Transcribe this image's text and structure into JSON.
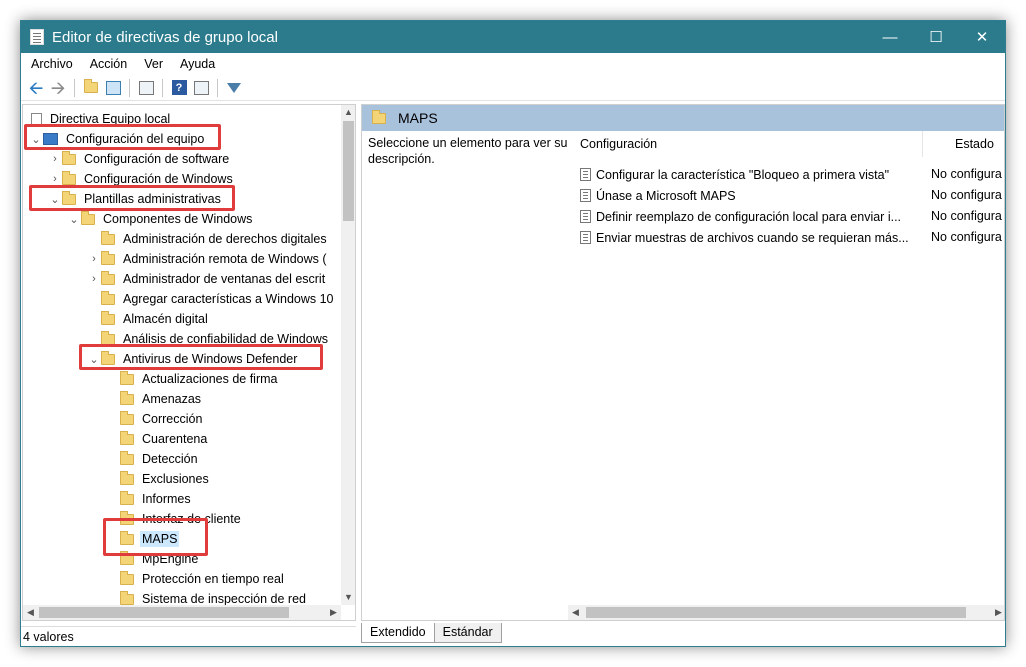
{
  "window": {
    "title": "Editor de directivas de grupo local"
  },
  "menu": [
    "Archivo",
    "Acción",
    "Ver",
    "Ayuda"
  ],
  "toolbar": {
    "icons": [
      "back-icon",
      "forward-icon",
      "up-folder-icon",
      "show-hide-tree-icon",
      "export-list-icon",
      "help-icon",
      "properties-icon",
      "filter-icon"
    ]
  },
  "tree": {
    "root": "Directiva Equipo local",
    "computer_config": "Configuración del equipo",
    "software_config": "Configuración de software",
    "windows_config": "Configuración de Windows",
    "admin_templates": "Plantillas administrativas",
    "windows_components": "Componentes de Windows",
    "items": [
      "Administración de derechos digitales",
      "Administración remota de Windows (",
      "Administrador de ventanas del escrit",
      "Agregar características a Windows 10",
      "Almacén digital",
      "Análisis de confiabilidad de Windows",
      "Antivirus de Windows Defender"
    ],
    "defender_children": [
      "Actualizaciones de firma",
      "Amenazas",
      "Corrección",
      "Cuarentena",
      "Detección",
      "Exclusiones",
      "Informes",
      "Interfaz de cliente",
      "MAPS",
      "MpEngine",
      "Protección en tiempo real",
      "Sistema de inspección de red"
    ]
  },
  "right": {
    "header": "MAPS",
    "description": "Seleccione un elemento para ver su descripción.",
    "columns": {
      "config": "Configuración",
      "state": "Estado"
    },
    "policies": [
      {
        "name": "Configurar la característica \"Bloqueo a primera vista\"",
        "state": "No configura"
      },
      {
        "name": "Únase a Microsoft MAPS",
        "state": "No configura"
      },
      {
        "name": "Definir reemplazo de configuración local para enviar i...",
        "state": "No configura"
      },
      {
        "name": "Enviar muestras de archivos cuando se requieran más...",
        "state": "No configura"
      }
    ]
  },
  "tabs": {
    "extended": "Extendido",
    "standard": "Estándar"
  },
  "status": {
    "text": "4 valores"
  }
}
